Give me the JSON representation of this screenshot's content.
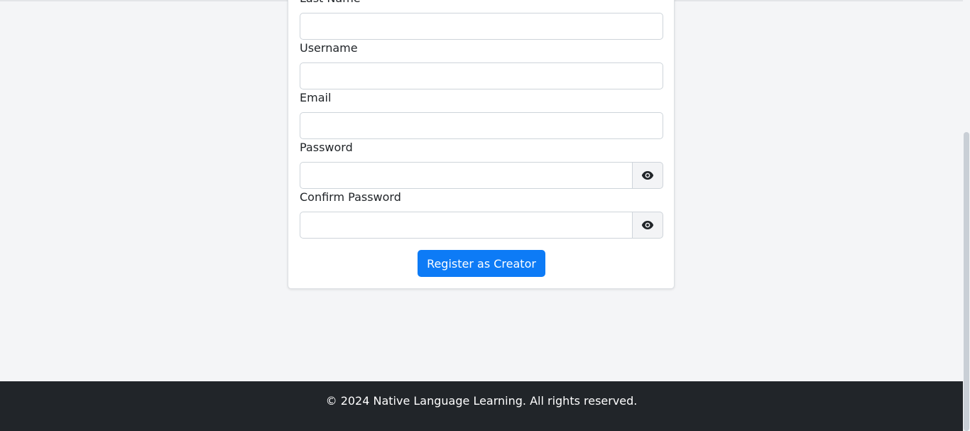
{
  "form": {
    "last_name_label": "Last Name",
    "username_label": "Username",
    "email_label": "Email",
    "password_label": "Password",
    "confirm_password_label": "Confirm Password",
    "last_name_value": "",
    "username_value": "",
    "email_value": "",
    "password_value": "",
    "confirm_password_value": "",
    "password_toggle_icon": "eye-icon",
    "submit_label": "Register as Creator"
  },
  "footer": {
    "text": "© 2024 Native Language Learning. All rights reserved."
  },
  "colors": {
    "primary": "#0d7bf6",
    "footer_bg": "#212529",
    "page_bg": "#f4f5f7"
  }
}
